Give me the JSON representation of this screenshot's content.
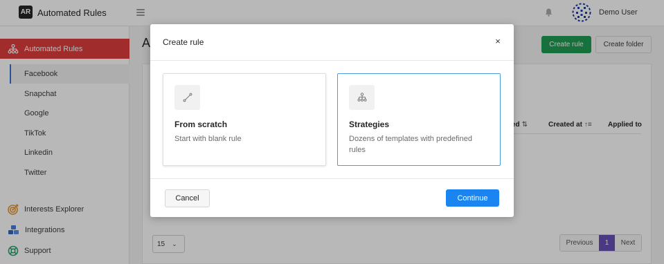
{
  "app": {
    "logo_text": "AR",
    "title": "Automated Rules"
  },
  "header": {
    "user_name": "Demo User"
  },
  "sidebar": {
    "main_item": {
      "label": "Automated Rules",
      "icon": "hierarchy-icon"
    },
    "platforms": [
      {
        "label": "Facebook",
        "active": true
      },
      {
        "label": "Snapchat",
        "active": false
      },
      {
        "label": "Google",
        "active": false
      },
      {
        "label": "TikTok",
        "active": false
      },
      {
        "label": "Linkedin",
        "active": false
      },
      {
        "label": "Twitter",
        "active": false
      }
    ],
    "tools": [
      {
        "label": "Interests Explorer",
        "icon": "target-icon"
      },
      {
        "label": "Integrations",
        "icon": "cubes-icon"
      },
      {
        "label": "Support",
        "icon": "lifebuoy-icon"
      }
    ]
  },
  "main": {
    "heading": "Au",
    "create_rule_label": "Create rule",
    "create_folder_label": "Create folder",
    "columns": [
      {
        "label": "red",
        "sort_glyph": "⇅"
      },
      {
        "label": "Created at",
        "sort_glyph": "↑≡"
      },
      {
        "label": "Applied to",
        "sort_glyph": ""
      }
    ],
    "per_page": "15",
    "pagination": {
      "prev": "Previous",
      "page": "1",
      "next": "Next"
    }
  },
  "modal": {
    "title": "Create rule",
    "close_glyph": "×",
    "options": [
      {
        "title": "From scratch",
        "description": "Start with blank rule",
        "icon": "line-icon",
        "selected": false
      },
      {
        "title": "Strategies",
        "description": "Dozens of templates with predefined rules",
        "icon": "hierarchy-icon",
        "selected": true
      }
    ],
    "cancel_label": "Cancel",
    "continue_label": "Continue"
  },
  "colors": {
    "accent_red": "#e03d3d",
    "create_green": "#1f9d55",
    "continue_blue": "#1a85f0",
    "pager_active": "#6a4fb6",
    "selected_border": "#4a9be0"
  }
}
